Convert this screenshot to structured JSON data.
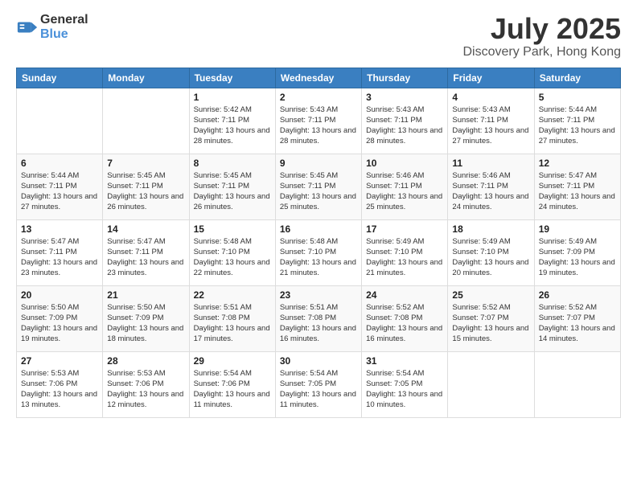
{
  "header": {
    "logo": {
      "text_general": "General",
      "text_blue": "Blue"
    },
    "title": "July 2025",
    "location": "Discovery Park, Hong Kong"
  },
  "weekdays": [
    "Sunday",
    "Monday",
    "Tuesday",
    "Wednesday",
    "Thursday",
    "Friday",
    "Saturday"
  ],
  "weeks": [
    [
      {
        "day": "",
        "info": ""
      },
      {
        "day": "",
        "info": ""
      },
      {
        "day": "1",
        "info": "Sunrise: 5:42 AM\nSunset: 7:11 PM\nDaylight: 13 hours\nand 28 minutes."
      },
      {
        "day": "2",
        "info": "Sunrise: 5:43 AM\nSunset: 7:11 PM\nDaylight: 13 hours\nand 28 minutes."
      },
      {
        "day": "3",
        "info": "Sunrise: 5:43 AM\nSunset: 7:11 PM\nDaylight: 13 hours\nand 28 minutes."
      },
      {
        "day": "4",
        "info": "Sunrise: 5:43 AM\nSunset: 7:11 PM\nDaylight: 13 hours\nand 27 minutes."
      },
      {
        "day": "5",
        "info": "Sunrise: 5:44 AM\nSunset: 7:11 PM\nDaylight: 13 hours\nand 27 minutes."
      }
    ],
    [
      {
        "day": "6",
        "info": "Sunrise: 5:44 AM\nSunset: 7:11 PM\nDaylight: 13 hours\nand 27 minutes."
      },
      {
        "day": "7",
        "info": "Sunrise: 5:45 AM\nSunset: 7:11 PM\nDaylight: 13 hours\nand 26 minutes."
      },
      {
        "day": "8",
        "info": "Sunrise: 5:45 AM\nSunset: 7:11 PM\nDaylight: 13 hours\nand 26 minutes."
      },
      {
        "day": "9",
        "info": "Sunrise: 5:45 AM\nSunset: 7:11 PM\nDaylight: 13 hours\nand 25 minutes."
      },
      {
        "day": "10",
        "info": "Sunrise: 5:46 AM\nSunset: 7:11 PM\nDaylight: 13 hours\nand 25 minutes."
      },
      {
        "day": "11",
        "info": "Sunrise: 5:46 AM\nSunset: 7:11 PM\nDaylight: 13 hours\nand 24 minutes."
      },
      {
        "day": "12",
        "info": "Sunrise: 5:47 AM\nSunset: 7:11 PM\nDaylight: 13 hours\nand 24 minutes."
      }
    ],
    [
      {
        "day": "13",
        "info": "Sunrise: 5:47 AM\nSunset: 7:11 PM\nDaylight: 13 hours\nand 23 minutes."
      },
      {
        "day": "14",
        "info": "Sunrise: 5:47 AM\nSunset: 7:11 PM\nDaylight: 13 hours\nand 23 minutes."
      },
      {
        "day": "15",
        "info": "Sunrise: 5:48 AM\nSunset: 7:10 PM\nDaylight: 13 hours\nand 22 minutes."
      },
      {
        "day": "16",
        "info": "Sunrise: 5:48 AM\nSunset: 7:10 PM\nDaylight: 13 hours\nand 21 minutes."
      },
      {
        "day": "17",
        "info": "Sunrise: 5:49 AM\nSunset: 7:10 PM\nDaylight: 13 hours\nand 21 minutes."
      },
      {
        "day": "18",
        "info": "Sunrise: 5:49 AM\nSunset: 7:10 PM\nDaylight: 13 hours\nand 20 minutes."
      },
      {
        "day": "19",
        "info": "Sunrise: 5:49 AM\nSunset: 7:09 PM\nDaylight: 13 hours\nand 19 minutes."
      }
    ],
    [
      {
        "day": "20",
        "info": "Sunrise: 5:50 AM\nSunset: 7:09 PM\nDaylight: 13 hours\nand 19 minutes."
      },
      {
        "day": "21",
        "info": "Sunrise: 5:50 AM\nSunset: 7:09 PM\nDaylight: 13 hours\nand 18 minutes."
      },
      {
        "day": "22",
        "info": "Sunrise: 5:51 AM\nSunset: 7:08 PM\nDaylight: 13 hours\nand 17 minutes."
      },
      {
        "day": "23",
        "info": "Sunrise: 5:51 AM\nSunset: 7:08 PM\nDaylight: 13 hours\nand 16 minutes."
      },
      {
        "day": "24",
        "info": "Sunrise: 5:52 AM\nSunset: 7:08 PM\nDaylight: 13 hours\nand 16 minutes."
      },
      {
        "day": "25",
        "info": "Sunrise: 5:52 AM\nSunset: 7:07 PM\nDaylight: 13 hours\nand 15 minutes."
      },
      {
        "day": "26",
        "info": "Sunrise: 5:52 AM\nSunset: 7:07 PM\nDaylight: 13 hours\nand 14 minutes."
      }
    ],
    [
      {
        "day": "27",
        "info": "Sunrise: 5:53 AM\nSunset: 7:06 PM\nDaylight: 13 hours\nand 13 minutes."
      },
      {
        "day": "28",
        "info": "Sunrise: 5:53 AM\nSunset: 7:06 PM\nDaylight: 13 hours\nand 12 minutes."
      },
      {
        "day": "29",
        "info": "Sunrise: 5:54 AM\nSunset: 7:06 PM\nDaylight: 13 hours\nand 11 minutes."
      },
      {
        "day": "30",
        "info": "Sunrise: 5:54 AM\nSunset: 7:05 PM\nDaylight: 13 hours\nand 11 minutes."
      },
      {
        "day": "31",
        "info": "Sunrise: 5:54 AM\nSunset: 7:05 PM\nDaylight: 13 hours\nand 10 minutes."
      },
      {
        "day": "",
        "info": ""
      },
      {
        "day": "",
        "info": ""
      }
    ]
  ]
}
